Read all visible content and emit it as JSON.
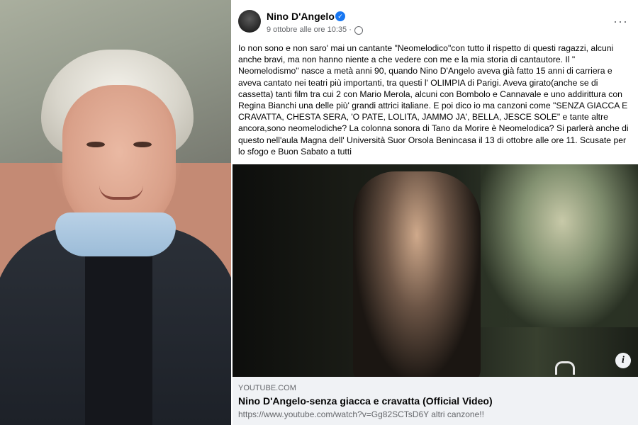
{
  "post": {
    "author": "Nino D'Angelo",
    "date": "9 ottobre alle ore 10:35 · ",
    "more_label": "···",
    "verified_glyph": "✓",
    "paragraphs": [
      "Io non sono e non saro' mai un cantante \"Neomelodico\"con tutto il rispetto di questi ragazzi, alcuni anche bravi, ma non hanno niente a che vedere con me e la mia storia di cantautore. Il \" Neomelodismo\" nasce a metà anni 90, quando Nino D'Angelo aveva già fatto 15 anni di carriera e aveva cantato nei teatri più importanti, tra questi l' OLIMPIA di Parigi. Aveva girato(anche se di cassetta) tanti film tra cui 2 con Mario Merola, alcuni con Bombolo e Cannavale e uno addirittura con Regina Bianchi una delle più' grandi attrici italiane. E poi dico io ma canzoni come \"SENZA GIACCA E CRAVATTA, CHESTA SERA, 'O PATE, LOLITA, JAMMO JA', BELLA, JESCE SOLE\" e tante altre ancora,sono neomelodiche? La colonna sonora di Tano da Morire è Neomelodica? Si parlerà anche di questo nell'aula Magna dell' Università Suor Orsola Benincasa il 13 di ottobre alle ore 11. Scusate per lo sfogo e Buon Sabato a tutti"
    ]
  },
  "link": {
    "domain": "YOUTUBE.COM",
    "title": "Nino D'Angelo-senza giacca e cravatta (Official Video)",
    "description": "https://www.youtube.com/watch?v=Gg82SCTsD6Y altri canzone!!"
  },
  "video": {
    "info_glyph": "i"
  },
  "colors": {
    "facebook_blue": "#1877f2",
    "link_preview_bg": "#f0f2f5",
    "secondary_text": "#65676b"
  }
}
